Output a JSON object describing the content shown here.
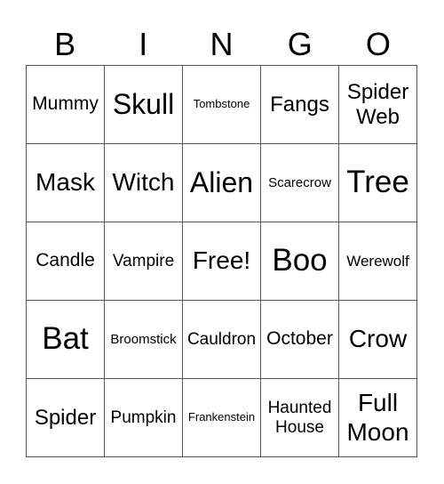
{
  "header": [
    "B",
    "I",
    "N",
    "G",
    "O"
  ],
  "cells": [
    [
      "Mummy",
      "Skull",
      "Tombstone",
      "Fangs",
      "Spider Web"
    ],
    [
      "Mask",
      "Witch",
      "Alien",
      "Scarecrow",
      "Tree"
    ],
    [
      "Candle",
      "Vampire",
      "Free!",
      "Boo",
      "Werewolf"
    ],
    [
      "Bat",
      "Broomstick",
      "Cauldron",
      "October",
      "Crow"
    ],
    [
      "Spider",
      "Pumpkin",
      "Frankenstein",
      "Haunted House",
      "Full Moon"
    ]
  ]
}
